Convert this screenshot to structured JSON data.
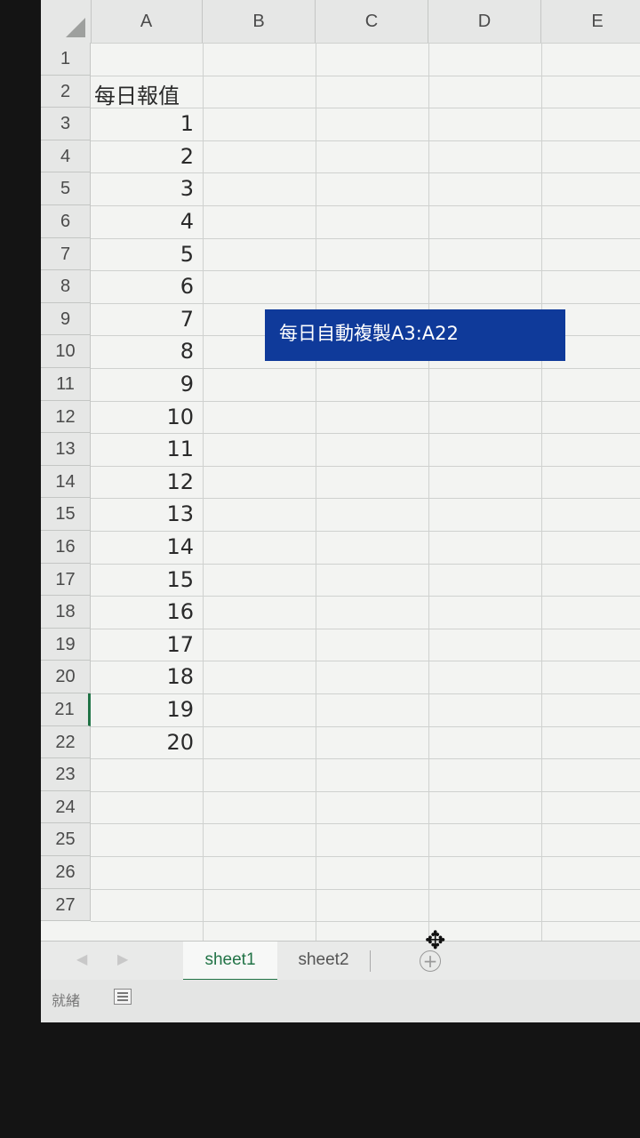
{
  "columns": [
    "A",
    "B",
    "C",
    "D",
    "E"
  ],
  "rows": [
    "1",
    "2",
    "3",
    "4",
    "5",
    "6",
    "7",
    "8",
    "9",
    "10",
    "11",
    "12",
    "13",
    "14",
    "15",
    "16",
    "17",
    "18",
    "19",
    "20",
    "21",
    "22",
    "23",
    "24",
    "25",
    "26",
    "27"
  ],
  "cells": {
    "A2": "每日報值",
    "A3": "1",
    "A4": "2",
    "A5": "3",
    "A6": "4",
    "A7": "5",
    "A8": "6",
    "A9": "7",
    "A10": "8",
    "A11": "9",
    "A12": "10",
    "A13": "11",
    "A14": "12",
    "A15": "13",
    "A16": "14",
    "A17": "15",
    "A18": "16",
    "A19": "17",
    "A20": "18",
    "A21": "19",
    "A22": "20"
  },
  "popup": {
    "text": "每日自動複製A3:A22"
  },
  "sheet_tabs": [
    "sheet1",
    "sheet2"
  ],
  "active_sheet": "sheet1",
  "status": "就緒",
  "icons": {
    "add_sheet": "plus-circle-icon",
    "cursor": "move-cursor-icon",
    "macro": "macro-record-icon"
  },
  "colors": {
    "accent": "#217346",
    "popup_bg": "#0f3a9a"
  }
}
